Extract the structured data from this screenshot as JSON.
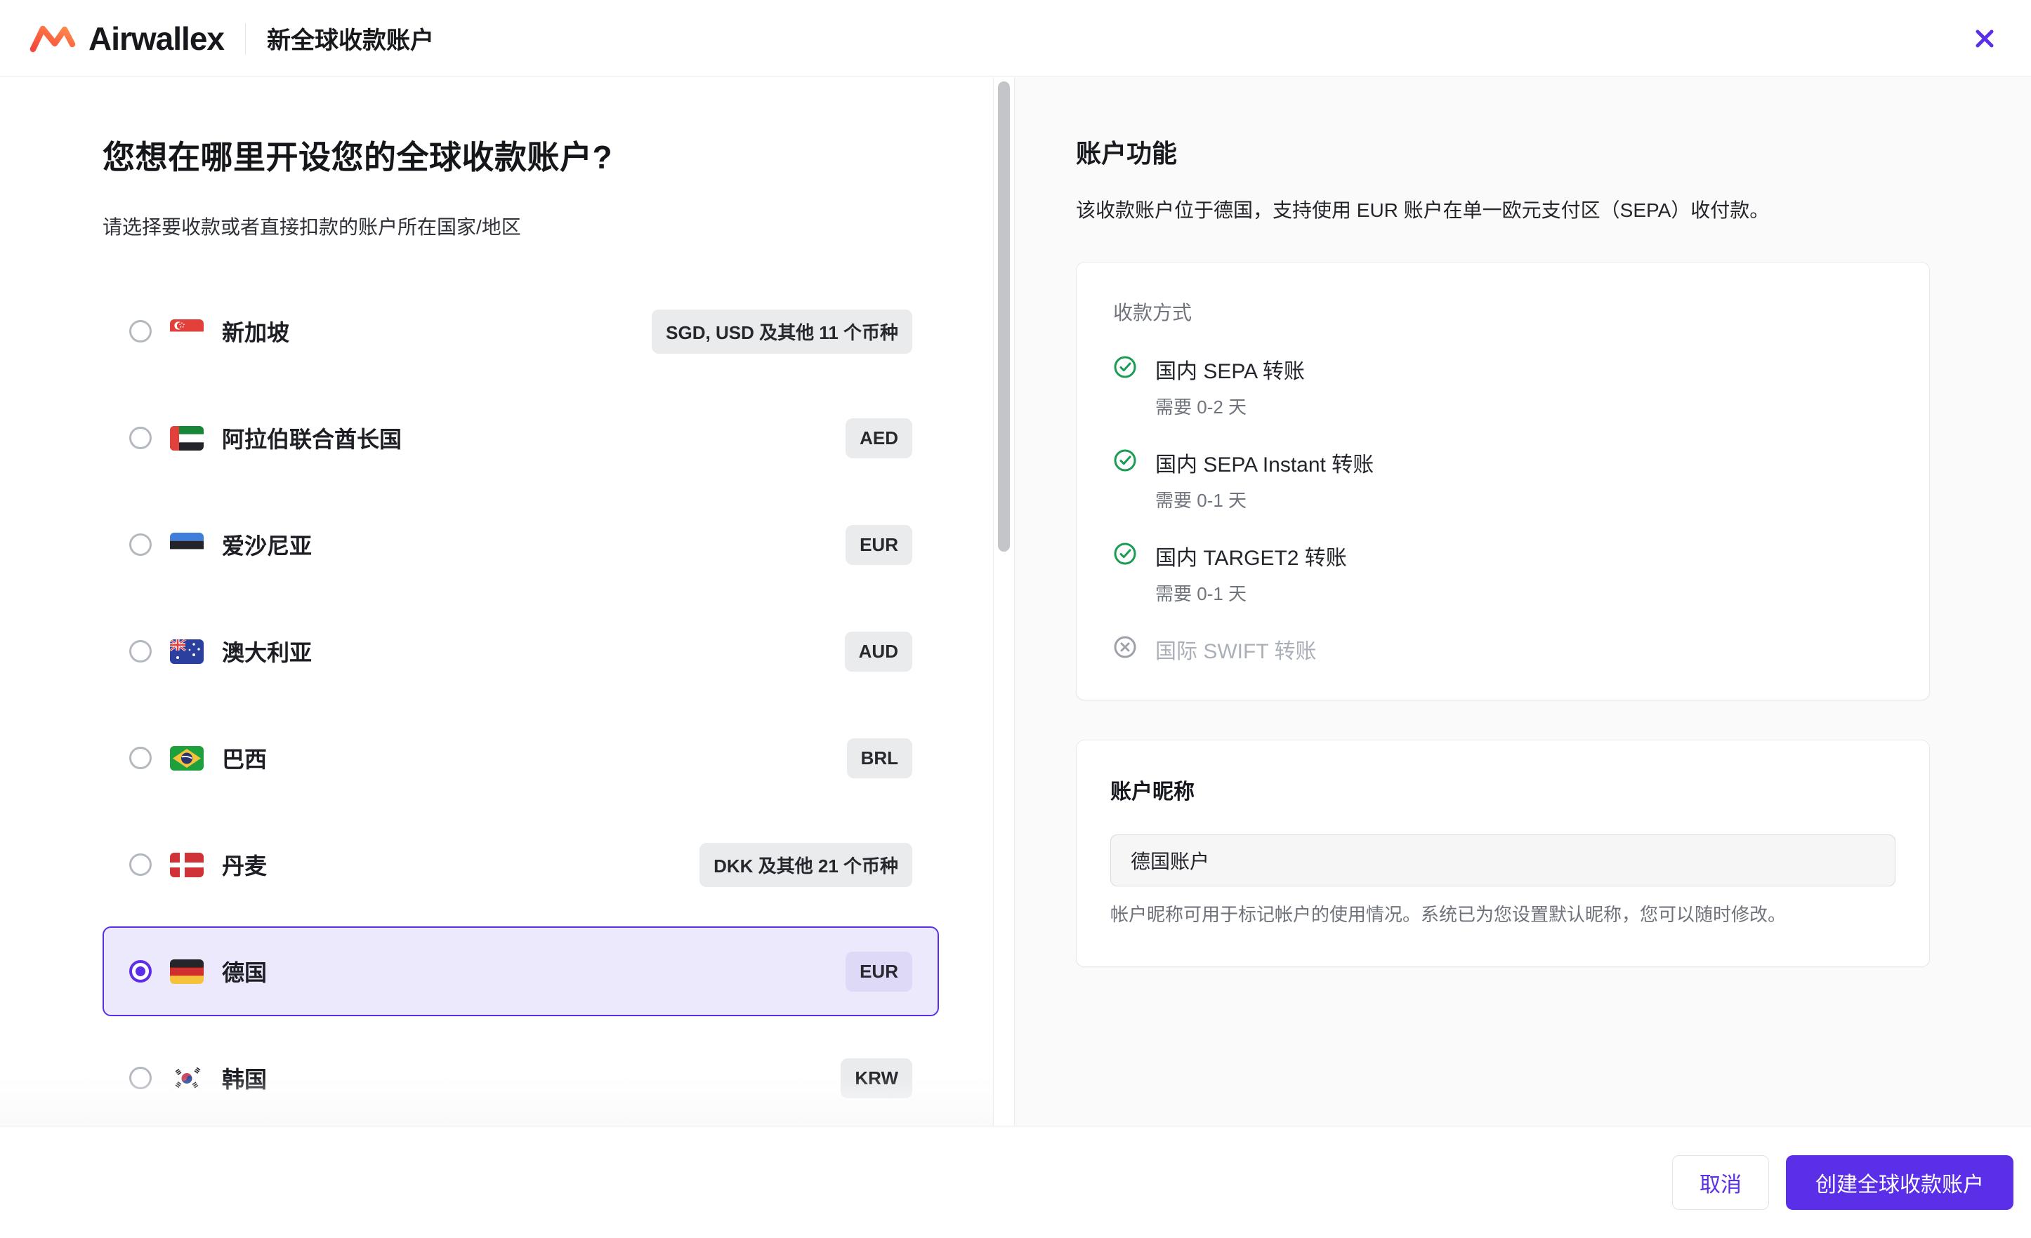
{
  "header": {
    "brand": "Airwallex",
    "title": "新全球收款账户"
  },
  "left": {
    "heading": "您想在哪里开设您的全球收款账户?",
    "subtitle": "请选择要收款或者直接扣款的账户所在国家/地区",
    "countries": [
      {
        "name": "新加坡",
        "badge": "SGD, USD 及其他 11 个币种",
        "selected": false
      },
      {
        "name": "阿拉伯联合酋长国",
        "badge": "AED",
        "selected": false
      },
      {
        "name": "爱沙尼亚",
        "badge": "EUR",
        "selected": false
      },
      {
        "name": "澳大利亚",
        "badge": "AUD",
        "selected": false
      },
      {
        "name": "巴西",
        "badge": "BRL",
        "selected": false
      },
      {
        "name": "丹麦",
        "badge": "DKK 及其他 21 个币种",
        "selected": false
      },
      {
        "name": "德国",
        "badge": "EUR",
        "selected": true
      },
      {
        "name": "韩国",
        "badge": "KRW",
        "selected": false
      }
    ]
  },
  "right": {
    "heading": "账户功能",
    "description": "该收款账户位于德国，支持使用 EUR 账户在单一欧元支付区（SEPA）收付款。",
    "methods": {
      "label": "收款方式",
      "items": [
        {
          "title": "国内 SEPA 转账",
          "duration": "需要 0-2 天",
          "enabled": true
        },
        {
          "title": "国内 SEPA Instant 转账",
          "duration": "需要 0-1 天",
          "enabled": true
        },
        {
          "title": "国内 TARGET2 转账",
          "duration": "需要 0-1 天",
          "enabled": true
        },
        {
          "title": "国际 SWIFT 转账",
          "duration": "",
          "enabled": false
        }
      ]
    },
    "nickname": {
      "label": "账户昵称",
      "value": "德国账户",
      "helper": "帐户昵称可用于标记帐户的使用情况。系统已为您设置默认昵称，您可以随时修改。"
    }
  },
  "footer": {
    "cancel": "取消",
    "submit": "创建全球收款账户"
  },
  "colors": {
    "accent": "#5b2fe8",
    "selected_row_bg": "#ede9fc",
    "selected_badge_bg": "#dfd9f8",
    "badge_bg": "#eaebed",
    "success_green": "#1b9c53",
    "disabled_gray": "#9ca1a9",
    "brand_gradient_start": "#f4473c",
    "brand_gradient_end": "#ff8f4d"
  }
}
